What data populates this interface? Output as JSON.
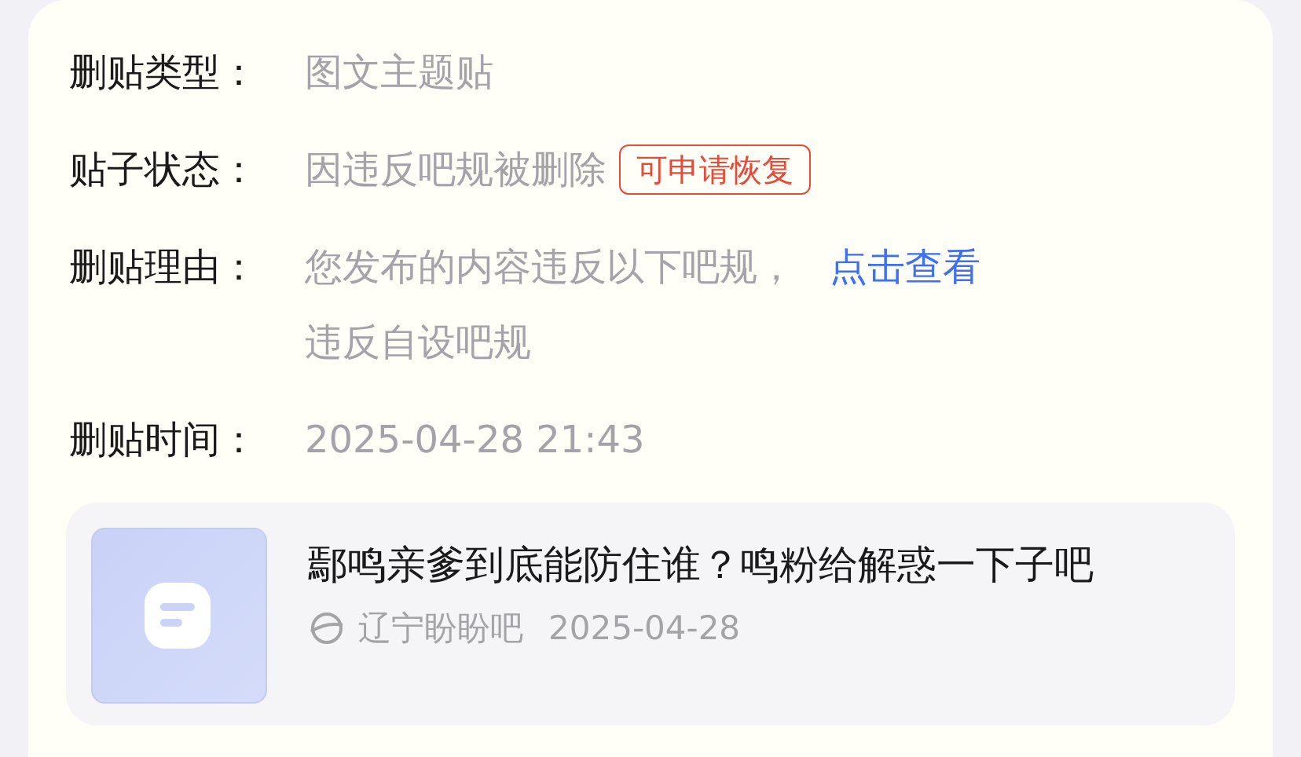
{
  "details": [
    {
      "label": "删贴类型：",
      "value": "图文主题贴"
    },
    {
      "label": "贴子状态：",
      "value": "因违反吧规被删除",
      "tag": "可申请恢复"
    },
    {
      "label": "删贴理由：",
      "value": "您发布的内容违反以下吧规，",
      "link": "点击查看",
      "extra": "违反自设吧规"
    },
    {
      "label": "删贴时间：",
      "value": "2025-04-28 21:43"
    }
  ],
  "post": {
    "title": "鄢鸣亲爹到底能防住谁？鸣粉给解惑一下子吧",
    "forum": "辽宁盼盼吧",
    "date": "2025-04-28"
  }
}
